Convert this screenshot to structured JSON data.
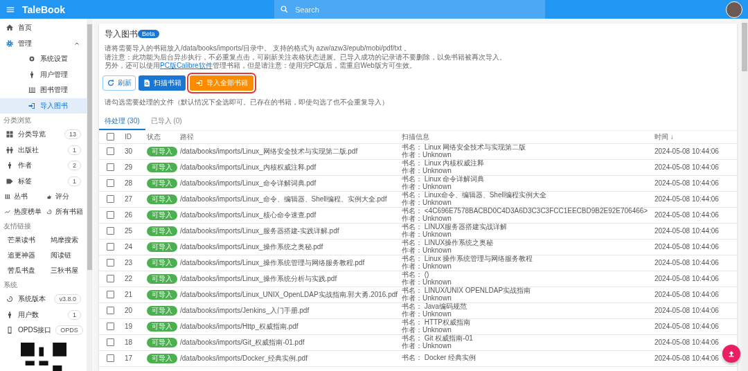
{
  "app_bar": {
    "title": "TaleBook",
    "search": {
      "placeholder": "Search"
    }
  },
  "sidebar": {
    "items": [
      {
        "label": "首页",
        "selected": false
      },
      {
        "label": "管理",
        "selected": false,
        "expanded": true,
        "children": [
          {
            "label": "系统设置",
            "selected": false
          },
          {
            "label": "用户管理",
            "selected": false
          },
          {
            "label": "图书管理",
            "selected": false
          },
          {
            "label": "导入图书",
            "selected": true
          }
        ]
      }
    ],
    "browse": {
      "heading": "分类浏览",
      "items": [
        {
          "label": "分类导览",
          "count": "13"
        },
        {
          "label": "出版社",
          "count": "1"
        },
        {
          "label": "作者",
          "count": "2"
        },
        {
          "label": "标签",
          "count": "1"
        }
      ],
      "pairs": [
        {
          "label": "丛书"
        },
        {
          "label": "评分"
        },
        {
          "label": "热度榜单"
        },
        {
          "label": "所有书籍"
        }
      ]
    },
    "links": {
      "heading": "友情链接",
      "items": [
        "芒果读书",
        "鸠摩搜索",
        "追更神器",
        "阅读链",
        "苦瓜书盘",
        "三秋书屋"
      ]
    },
    "system": {
      "heading": "系统",
      "items": [
        {
          "label": "系统版本",
          "value": "v3.8.0"
        },
        {
          "label": "用户数",
          "value": "1"
        },
        {
          "label": "OPDS接口",
          "value": "OPDS"
        }
      ]
    }
  },
  "page": {
    "title": "导入图书",
    "badge": "Beta",
    "notes": [
      {
        "text": "请将需要导入的书籍放入/data/books/imports/目录中。 支持的格式为 azw/azw3/epub/mobi/pdf/txt 。"
      },
      {
        "text": "请注意：此功能为后台异步执行，不必重复点击，可刷新关注表格状态进展。已导入成功的记录请不要删除，以免书籍被再次导入。"
      },
      {
        "text": "另外，还可以使用",
        "link": "PC版Calibre软件",
        "after": "管理书籍，但是请注意：使用完PC版后，需重启Web版方可生效。"
      }
    ],
    "buttons": [
      {
        "label": "刷新",
        "kind": "outlined",
        "highlighted": false
      },
      {
        "label": "扫描书籍",
        "kind": "primary",
        "highlighted": false
      },
      {
        "label": "导入全部书籍",
        "kind": "warning",
        "highlighted": true
      }
    ],
    "hint": "请勾选需要处理的文件（默认情况下全选即可。已存在的书籍，即使勾选了也不会重复导入）",
    "tabs": [
      {
        "label": "待处理 (30)",
        "selected": true
      },
      {
        "label": "已导入 (0)",
        "selected": false
      }
    ],
    "table": {
      "columns": [
        "ID",
        "状态",
        "路径",
        "扫描信息",
        "时间 ↓"
      ],
      "all_checked": false,
      "rows": [
        {
          "checked": false,
          "id": "30",
          "status": "可导入",
          "path": "/data/books/imports/Linux_网络安全技术与实现第二版.pdf",
          "title": "书名：  Linux 网络安全技术与实现第二版",
          "author": "作者：Unknown",
          "time": "2024-05-08 10:44:06"
        },
        {
          "checked": false,
          "id": "29",
          "status": "可导入",
          "path": "/data/books/imports/Linux_内核权威注释.pdf",
          "title": "书名：  Linux 内核权威注释",
          "author": "作者：Unknown",
          "time": "2024-05-08 10:44:06"
        },
        {
          "checked": false,
          "id": "28",
          "status": "可导入",
          "path": "/data/books/imports/Linux_命令详解词典.pdf",
          "title": "书名：  Linux 命令详解词典",
          "author": "作者：Unknown",
          "time": "2024-05-08 10:44:06"
        },
        {
          "checked": false,
          "id": "27",
          "status": "可导入",
          "path": "/data/books/imports/Linux_命令、编辑器、Shell编程、实例大全.pdf",
          "title": "书名：  Linux命令、编辑器、Shell编程实例大全",
          "author": "作者：Unknown",
          "time": "2024-05-08 10:44:06"
        },
        {
          "checked": false,
          "id": "26",
          "status": "可导入",
          "path": "/data/books/imports/Linux_核心命令速查.pdf",
          "title": "书名：  <4C696E7578BACBD0C4D3A6D3C3C3FCC1EECBD9B2E92E706466>",
          "author": "作者：Unknown",
          "time": "2024-05-08 10:44:06"
        },
        {
          "checked": false,
          "id": "25",
          "status": "可导入",
          "path": "/data/books/imports/Linux_服务器搭建-实践详解.pdf",
          "title": "书名：  LINUX服务器搭建实战详解",
          "author": "作者：Unknown",
          "time": "2024-05-08 10:44:06"
        },
        {
          "checked": false,
          "id": "24",
          "status": "可导入",
          "path": "/data/books/imports/Linux_操作系统之奥秘.pdf",
          "title": "书名：  LINUX操作系统之奥秘",
          "author": "作者：Unknown",
          "time": "2024-05-08 10:44:06"
        },
        {
          "checked": false,
          "id": "23",
          "status": "可导入",
          "path": "/data/books/imports/Linux_操作系统管理与网络服务教程.pdf",
          "title": "书名：  Linux 操作系统管理与网络服务教程",
          "author": "作者：Unknown",
          "time": "2024-05-08 10:44:06"
        },
        {
          "checked": false,
          "id": "22",
          "status": "可导入",
          "path": "/data/books/imports/Linux_操作系统分析与实践.pdf",
          "title": "书名：  ()",
          "author": "作者：Unknown",
          "time": "2024-05-08 10:44:06"
        },
        {
          "checked": false,
          "id": "21",
          "status": "可导入",
          "path": "/data/books/imports/Linux_UNIX_OpenLDAP实战指南.郭大勇.2016.pdf",
          "title": "书名：  LINUX/UNIX OPENLDAP实战指南",
          "author": "作者：Unknown",
          "time": "2024-05-08 10:44:06"
        },
        {
          "checked": false,
          "id": "20",
          "status": "可导入",
          "path": "/data/books/imports/Jenkins_入门手册.pdf",
          "title": "书名：  Java编码规范",
          "author": "作者：Unknown",
          "time": "2024-05-08 10:44:06"
        },
        {
          "checked": false,
          "id": "19",
          "status": "可导入",
          "path": "/data/books/imports/Http_权威指南.pdf",
          "title": "书名：  HTTP权威指南",
          "author": "作者：Unknown",
          "time": "2024-05-08 10:44:06"
        },
        {
          "checked": false,
          "id": "18",
          "status": "可导入",
          "path": "/data/books/imports/Git_权威指南-01.pdf",
          "title": "书名：  Git 权威指南-01",
          "author": "作者：Unknown",
          "time": "2024-05-08 10:44:06"
        },
        {
          "checked": false,
          "id": "17",
          "status": "可导入",
          "path": "/data/books/imports/Docker_经典实例.pdf",
          "title": "书名：  Docker 经典实例",
          "time": "2024-05-08 10:44:06"
        }
      ]
    }
  }
}
